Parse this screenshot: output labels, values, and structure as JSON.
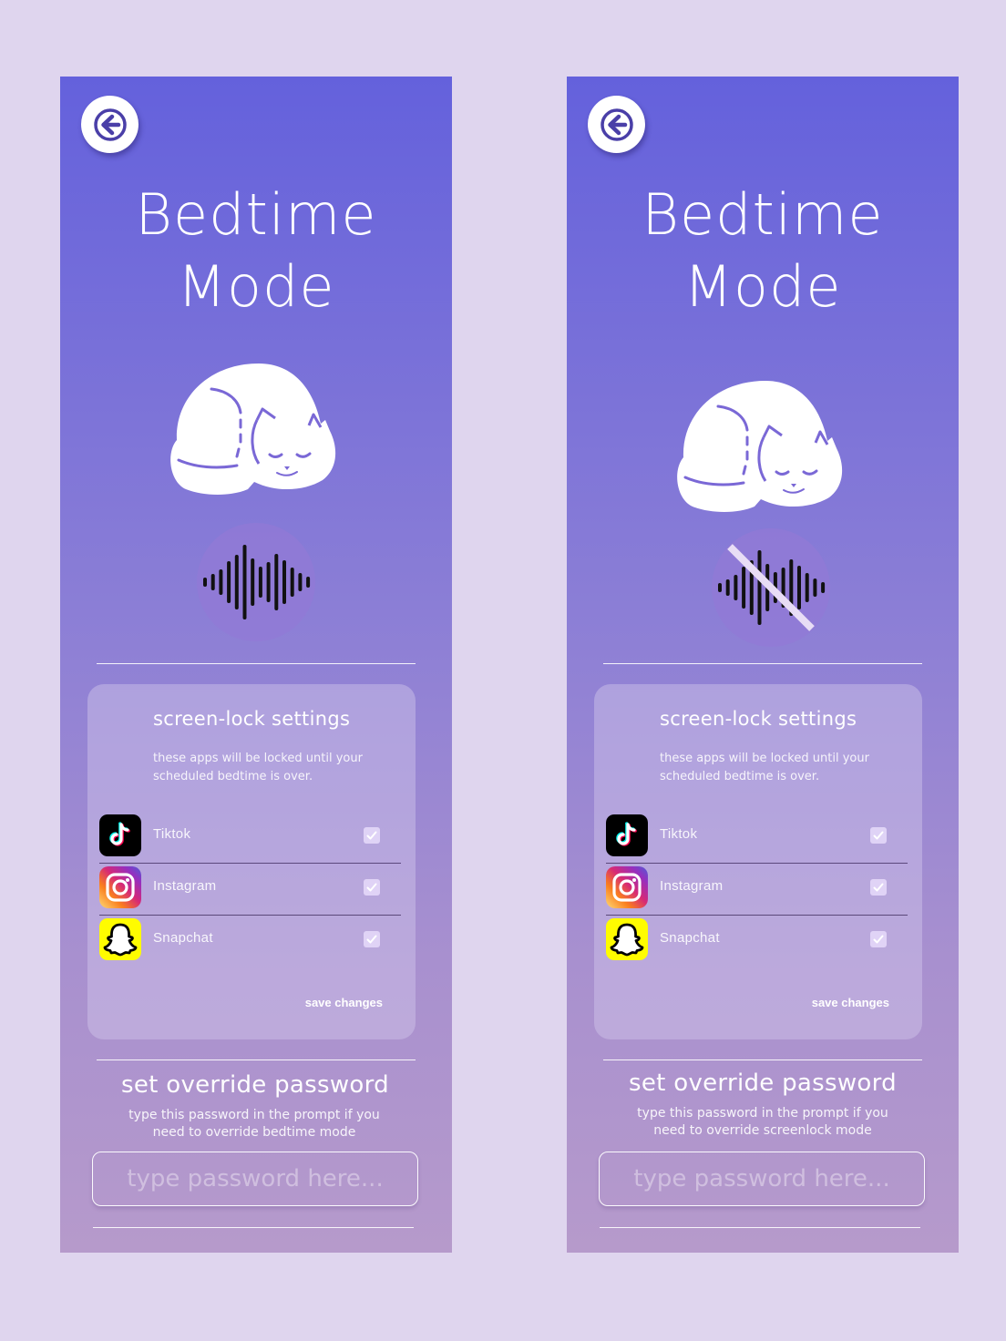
{
  "screens": [
    {
      "title_line1": "Bedtime",
      "title_line2": "Mode",
      "sound_state": "on",
      "lock_card": {
        "title": "screen-lock settings",
        "description": "these apps will be locked until your scheduled bedtime is over.",
        "apps": [
          {
            "name": "Tiktok",
            "icon": "tiktok-icon",
            "checked": true
          },
          {
            "name": "Instagram",
            "icon": "instagram-icon",
            "checked": true
          },
          {
            "name": "Snapchat",
            "icon": "snapchat-icon",
            "checked": true
          }
        ],
        "save_label": "save changes"
      },
      "password": {
        "title": "set override password",
        "desc_line1": "type this password in the prompt if you",
        "desc_line2": "need to override bedtime mode",
        "placeholder": "type password here..."
      }
    },
    {
      "title_line1": "Bedtime",
      "title_line2": "Mode",
      "sound_state": "muted",
      "lock_card": {
        "title": "screen-lock settings",
        "description": "these apps will be locked until your scheduled bedtime is over.",
        "apps": [
          {
            "name": "Tiktok",
            "icon": "tiktok-icon",
            "checked": true
          },
          {
            "name": "Instagram",
            "icon": "instagram-icon",
            "checked": true
          },
          {
            "name": "Snapchat",
            "icon": "snapchat-icon",
            "checked": true
          }
        ],
        "save_label": "save changes"
      },
      "password": {
        "title": "set override password",
        "desc_line1": "type this password in the prompt if you",
        "desc_line2": "need to override screenlock mode",
        "placeholder": "type password here..."
      }
    }
  ],
  "colors": {
    "background": "#dfd5ee",
    "gradient_top": "#6461dc",
    "gradient_bottom": "#b69acb",
    "accent_purple": "#5b4bc4",
    "snapchat_yellow": "#fffc00"
  }
}
